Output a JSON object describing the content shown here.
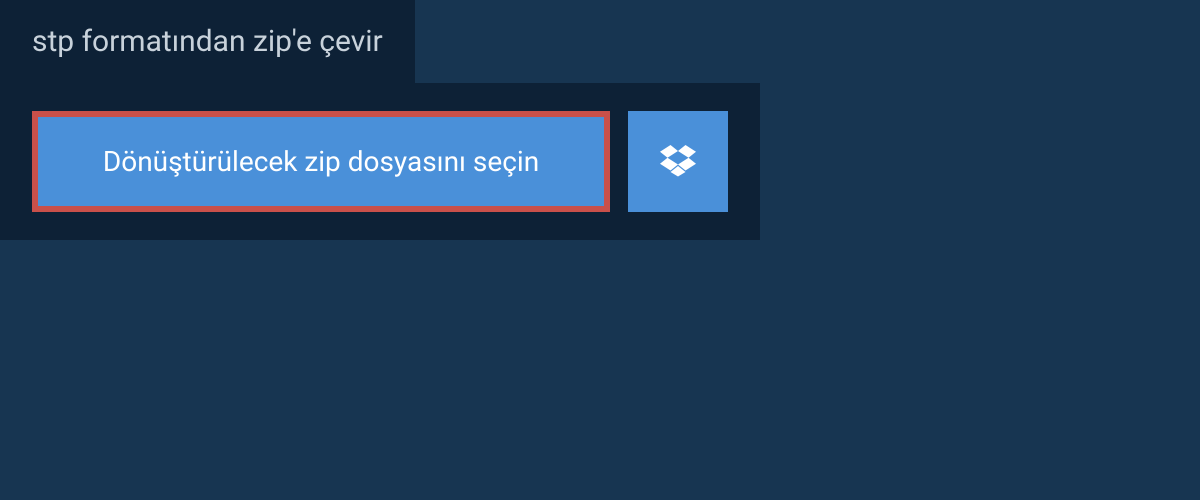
{
  "header": {
    "title": "stp formatından zip'e çevir"
  },
  "actions": {
    "select_file_label": "Dönüştürülecek zip dosyasını seçin"
  },
  "colors": {
    "background": "#173551",
    "panel": "#0d2136",
    "button": "#4a90d9",
    "button_border": "#c9504a",
    "text_light": "#c8d2db",
    "text_white": "#ffffff"
  }
}
